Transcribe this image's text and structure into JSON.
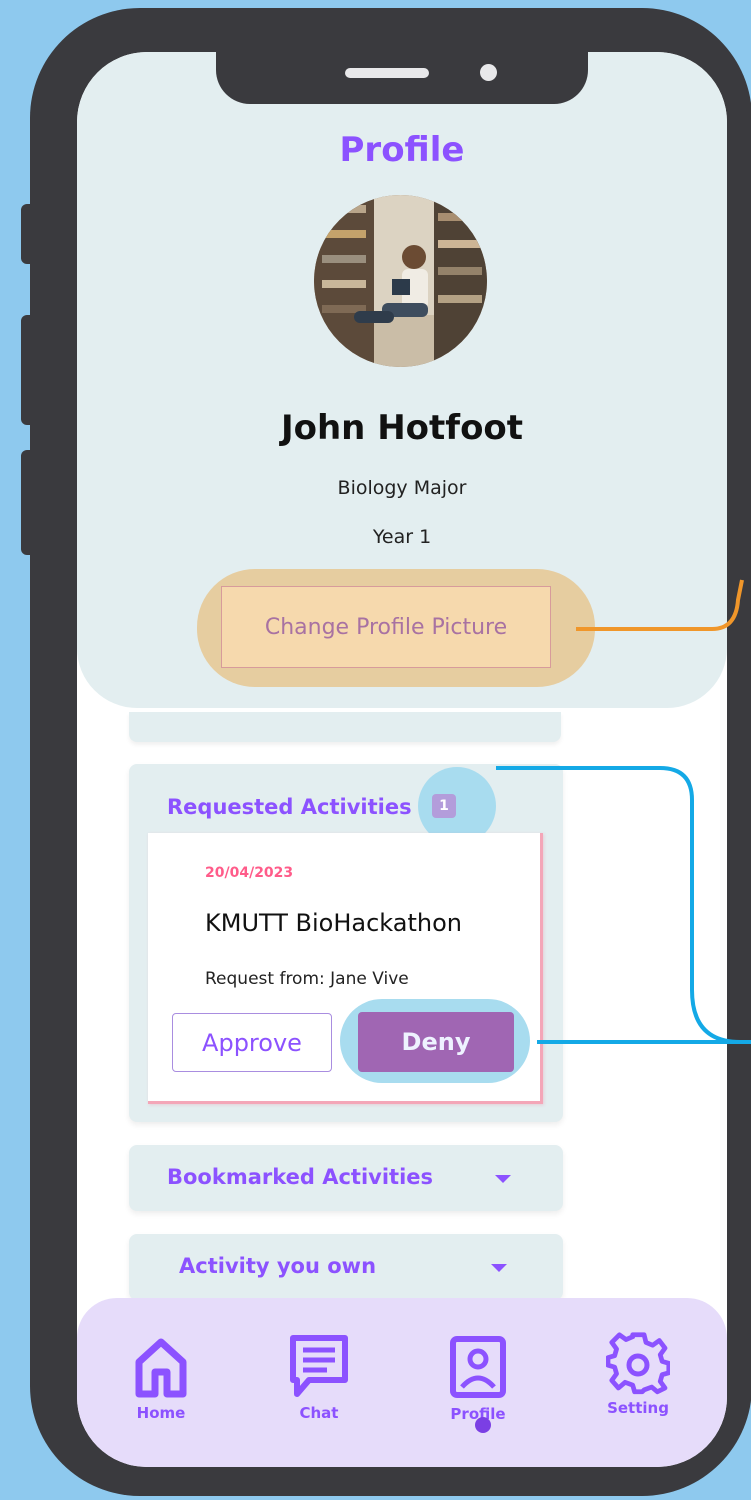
{
  "header": {
    "title": "Profile",
    "name": "John Hotfoot",
    "major": "Biology Major",
    "year": "Year 1",
    "change_picture_label": "Change Profile Picture"
  },
  "requested": {
    "title": "Requested Activities",
    "count": "1",
    "activity": {
      "date": "20/04/2023",
      "name": "KMUTT BioHackathon",
      "request_from": "Request from: Jane Vive",
      "approve_label": "Approve",
      "deny_label": "Deny"
    }
  },
  "sections": {
    "bookmarked_label": "Bookmarked Activities",
    "owned_label": "Activity you own"
  },
  "tabs": [
    {
      "label": "Home",
      "icon": "home-icon"
    },
    {
      "label": "Chat",
      "icon": "chat-icon"
    },
    {
      "label": "Profile",
      "icon": "profile-icon"
    },
    {
      "label": "Setting",
      "icon": "gear-icon"
    }
  ],
  "colors": {
    "accent": "#8c52ff",
    "background": "#8ec9ee",
    "panel": "#e3eef0",
    "tab_bar": "#e6dcfa",
    "deny": "#a066b3",
    "date": "#ff5c8a",
    "highlight_orange": "#e6cda0",
    "highlight_blue": "#a8dcef",
    "connector_orange": "#f0962a",
    "connector_blue": "#14a9e6"
  }
}
